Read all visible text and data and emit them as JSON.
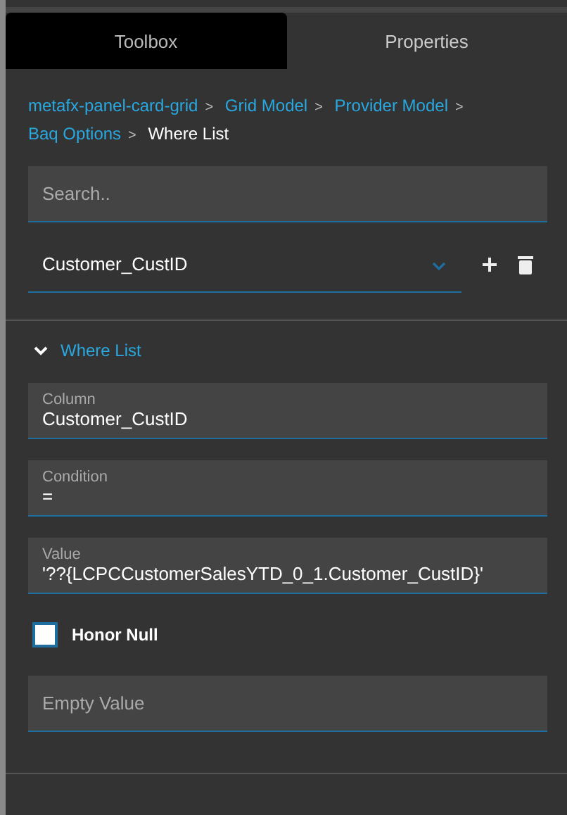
{
  "tabs": [
    {
      "label": "Toolbox",
      "selected": true
    },
    {
      "label": "Properties",
      "selected": false
    }
  ],
  "breadcrumb": [
    {
      "label": "metafx-panel-card-grid",
      "current": false
    },
    {
      "label": "Grid Model",
      "current": false
    },
    {
      "label": "Provider Model",
      "current": false
    },
    {
      "label": "Baq Options",
      "current": false
    },
    {
      "label": "Where List",
      "current": true
    }
  ],
  "breadcrumb_separator": ">",
  "search": {
    "placeholder": "Search.."
  },
  "selector": {
    "value": "Customer_CustID"
  },
  "section": {
    "title": "Where List",
    "expanded": true
  },
  "fields": [
    {
      "label": "Column",
      "value": "Customer_CustID"
    },
    {
      "label": "Condition",
      "value": "="
    },
    {
      "label": "Value",
      "value": "'??{LCPCCustomerSalesYTD_0_1.Customer_CustID}'"
    }
  ],
  "honor_null": {
    "label": "Honor Null",
    "checked": false
  },
  "empty_value": {
    "placeholder": "Empty Value"
  }
}
